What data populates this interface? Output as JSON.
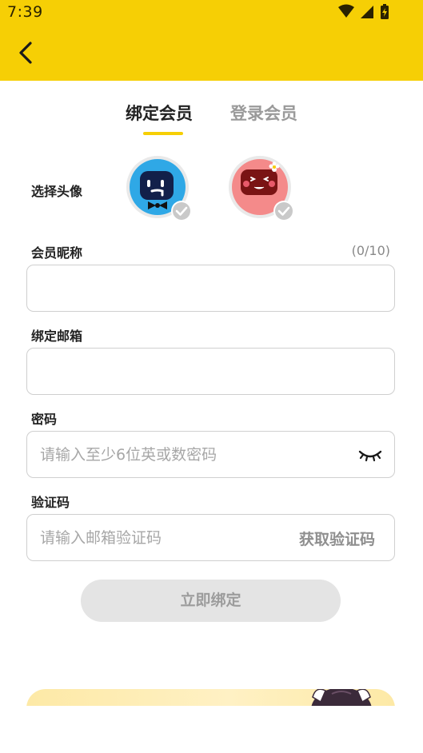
{
  "status_bar": {
    "time": "7:39"
  },
  "header": {
    "back_icon": "chevron-left-icon"
  },
  "tabs": [
    {
      "label": "绑定会员",
      "active": true
    },
    {
      "label": "登录会员",
      "active": false
    }
  ],
  "avatar_section": {
    "label": "选择头像",
    "options": [
      {
        "name": "blue-mascot-avatar",
        "color": "#2fa8e6"
      },
      {
        "name": "pink-mascot-avatar",
        "color": "#f48a8a"
      }
    ]
  },
  "nickname": {
    "label": "会员昵称",
    "counter": "(0/10)",
    "value": "",
    "placeholder": ""
  },
  "email": {
    "label": "绑定邮箱",
    "value": "",
    "placeholder": ""
  },
  "password": {
    "label": "密码",
    "placeholder": "请输入至少6位英或数密码",
    "toggle_icon": "eye-closed-icon"
  },
  "code": {
    "label": "验证码",
    "placeholder": "请输入邮箱验证码",
    "get_code_label": "获取验证码"
  },
  "submit": {
    "label": "立即绑定"
  },
  "colors": {
    "accent": "#f6cf05",
    "disabled_button": "#e4e4e4",
    "field_border": "#cfcfcf"
  }
}
